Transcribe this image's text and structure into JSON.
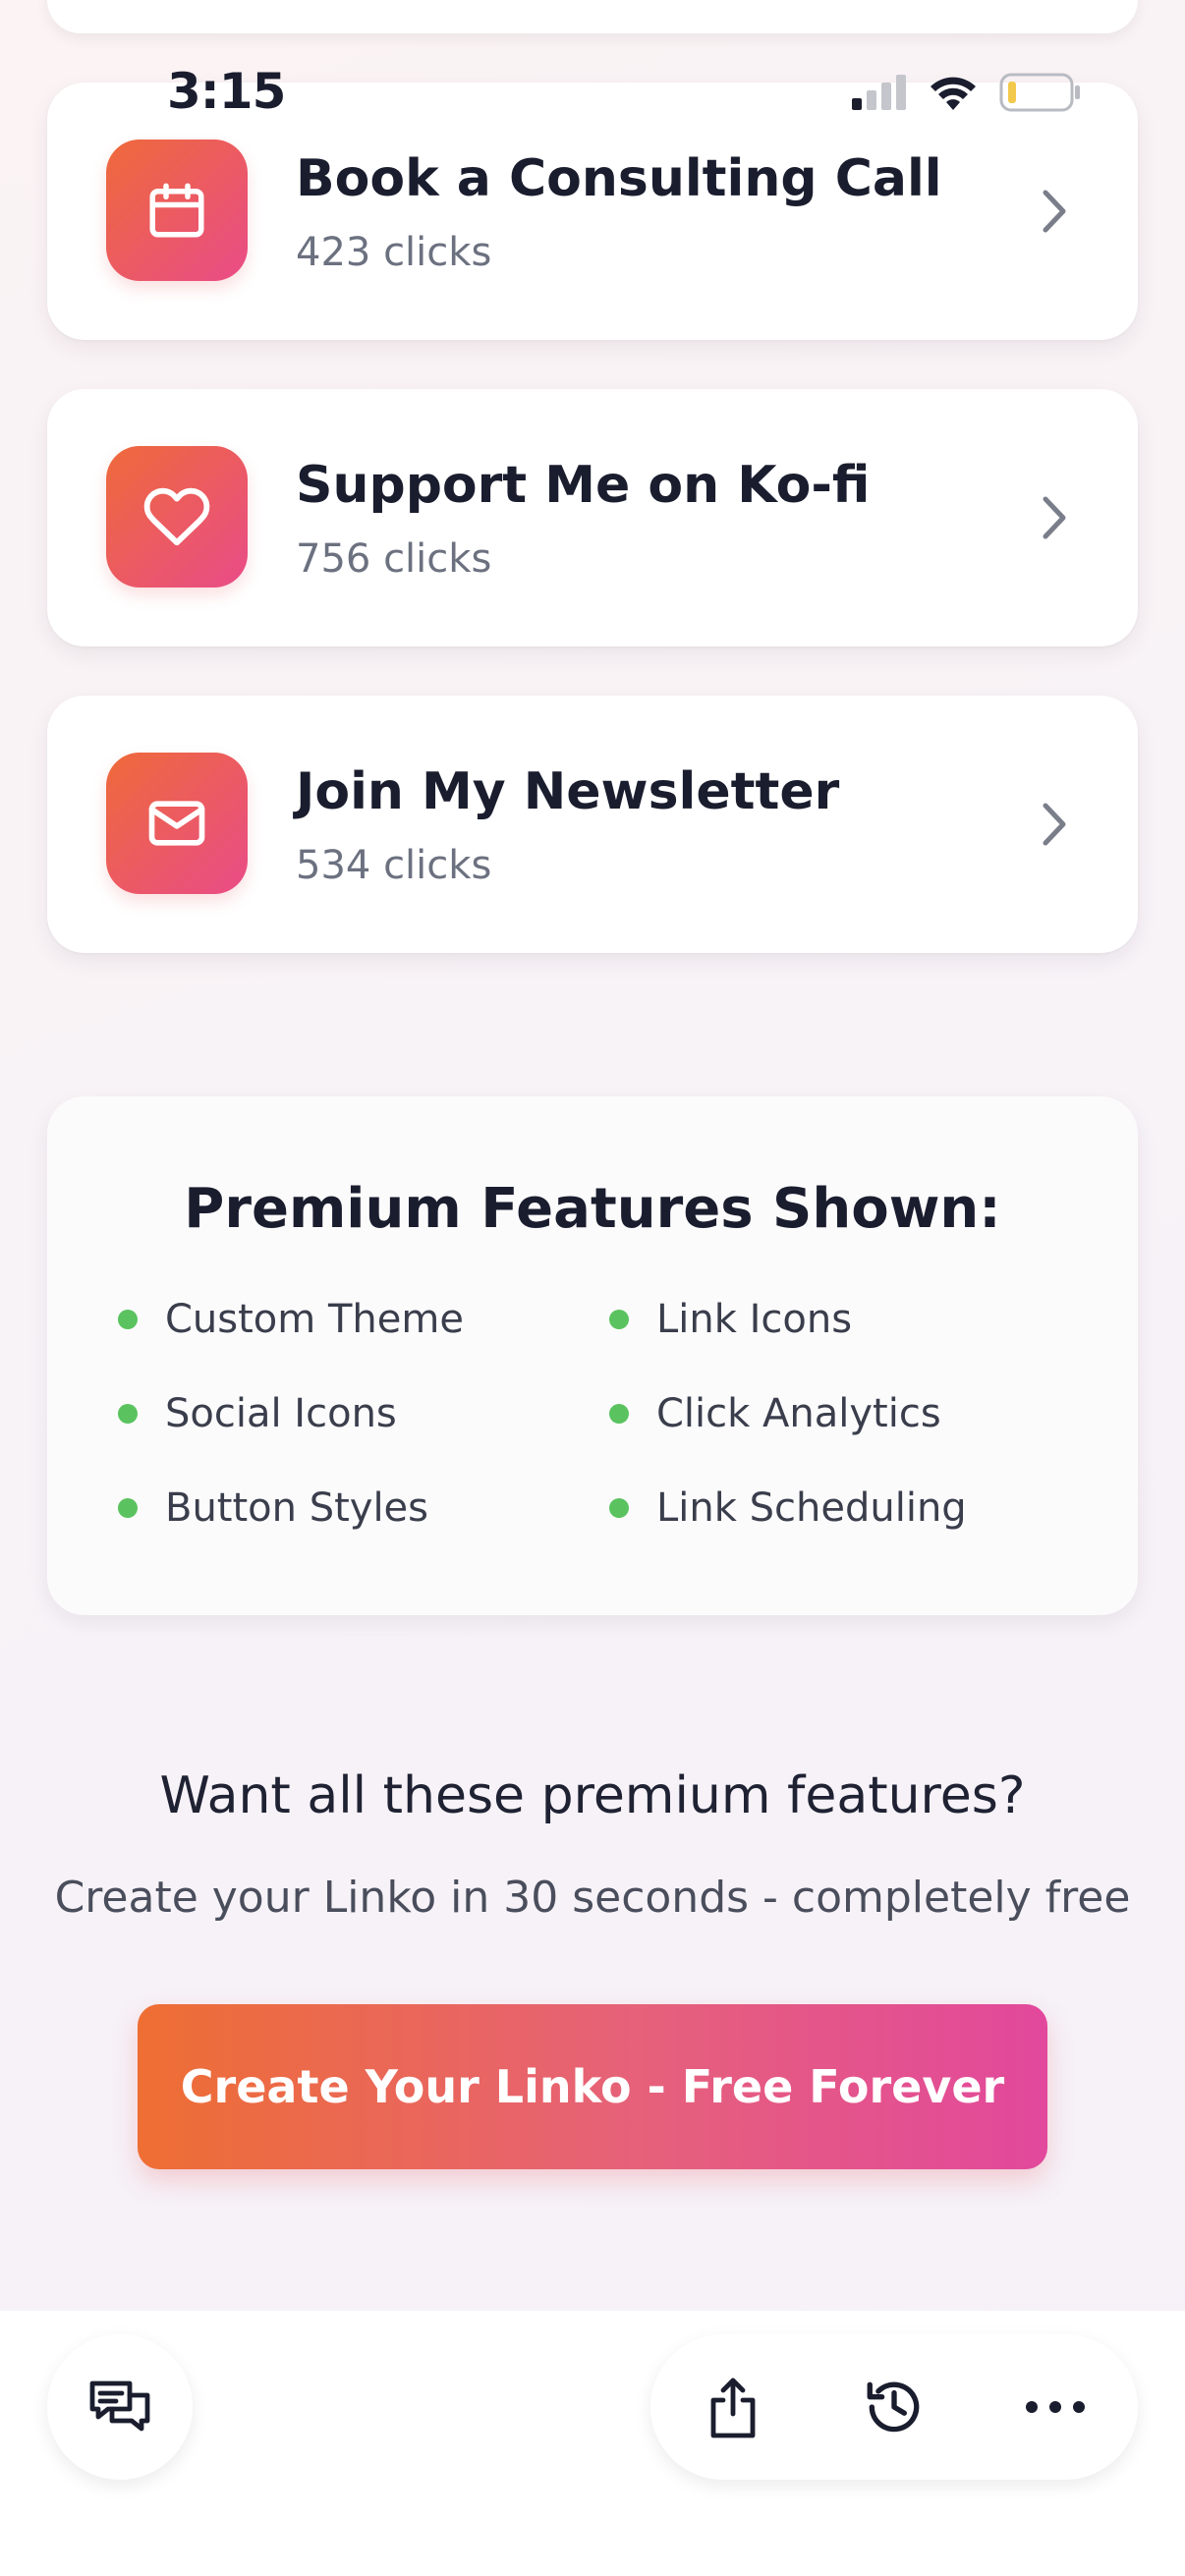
{
  "status_bar": {
    "time": "3:15"
  },
  "links": [
    {
      "title": "Book a Consulting Call",
      "clicks": "423 clicks",
      "icon": "calendar-icon"
    },
    {
      "title": "Support Me on Ko-fi",
      "clicks": "756 clicks",
      "icon": "heart-icon"
    },
    {
      "title": "Join My Newsletter",
      "clicks": "534 clicks",
      "icon": "mail-icon"
    }
  ],
  "premium": {
    "title": "Premium Features Shown:",
    "features": [
      "Custom Theme",
      "Link Icons",
      "Social Icons",
      "Click Analytics",
      "Button Styles",
      "Link Scheduling"
    ]
  },
  "cta": {
    "heading": "Want all these premium features?",
    "subheading": "Create your Linko in 30 seconds - completely free",
    "button_label": "Create Your Linko - Free Forever"
  },
  "toolbar": {
    "icons": [
      "chat-icon",
      "share-icon",
      "history-icon",
      "more-icon"
    ]
  },
  "colors": {
    "accent_start": "#ee6a3a",
    "accent_end": "#e94c88",
    "feature_dot": "#5ac35f"
  }
}
